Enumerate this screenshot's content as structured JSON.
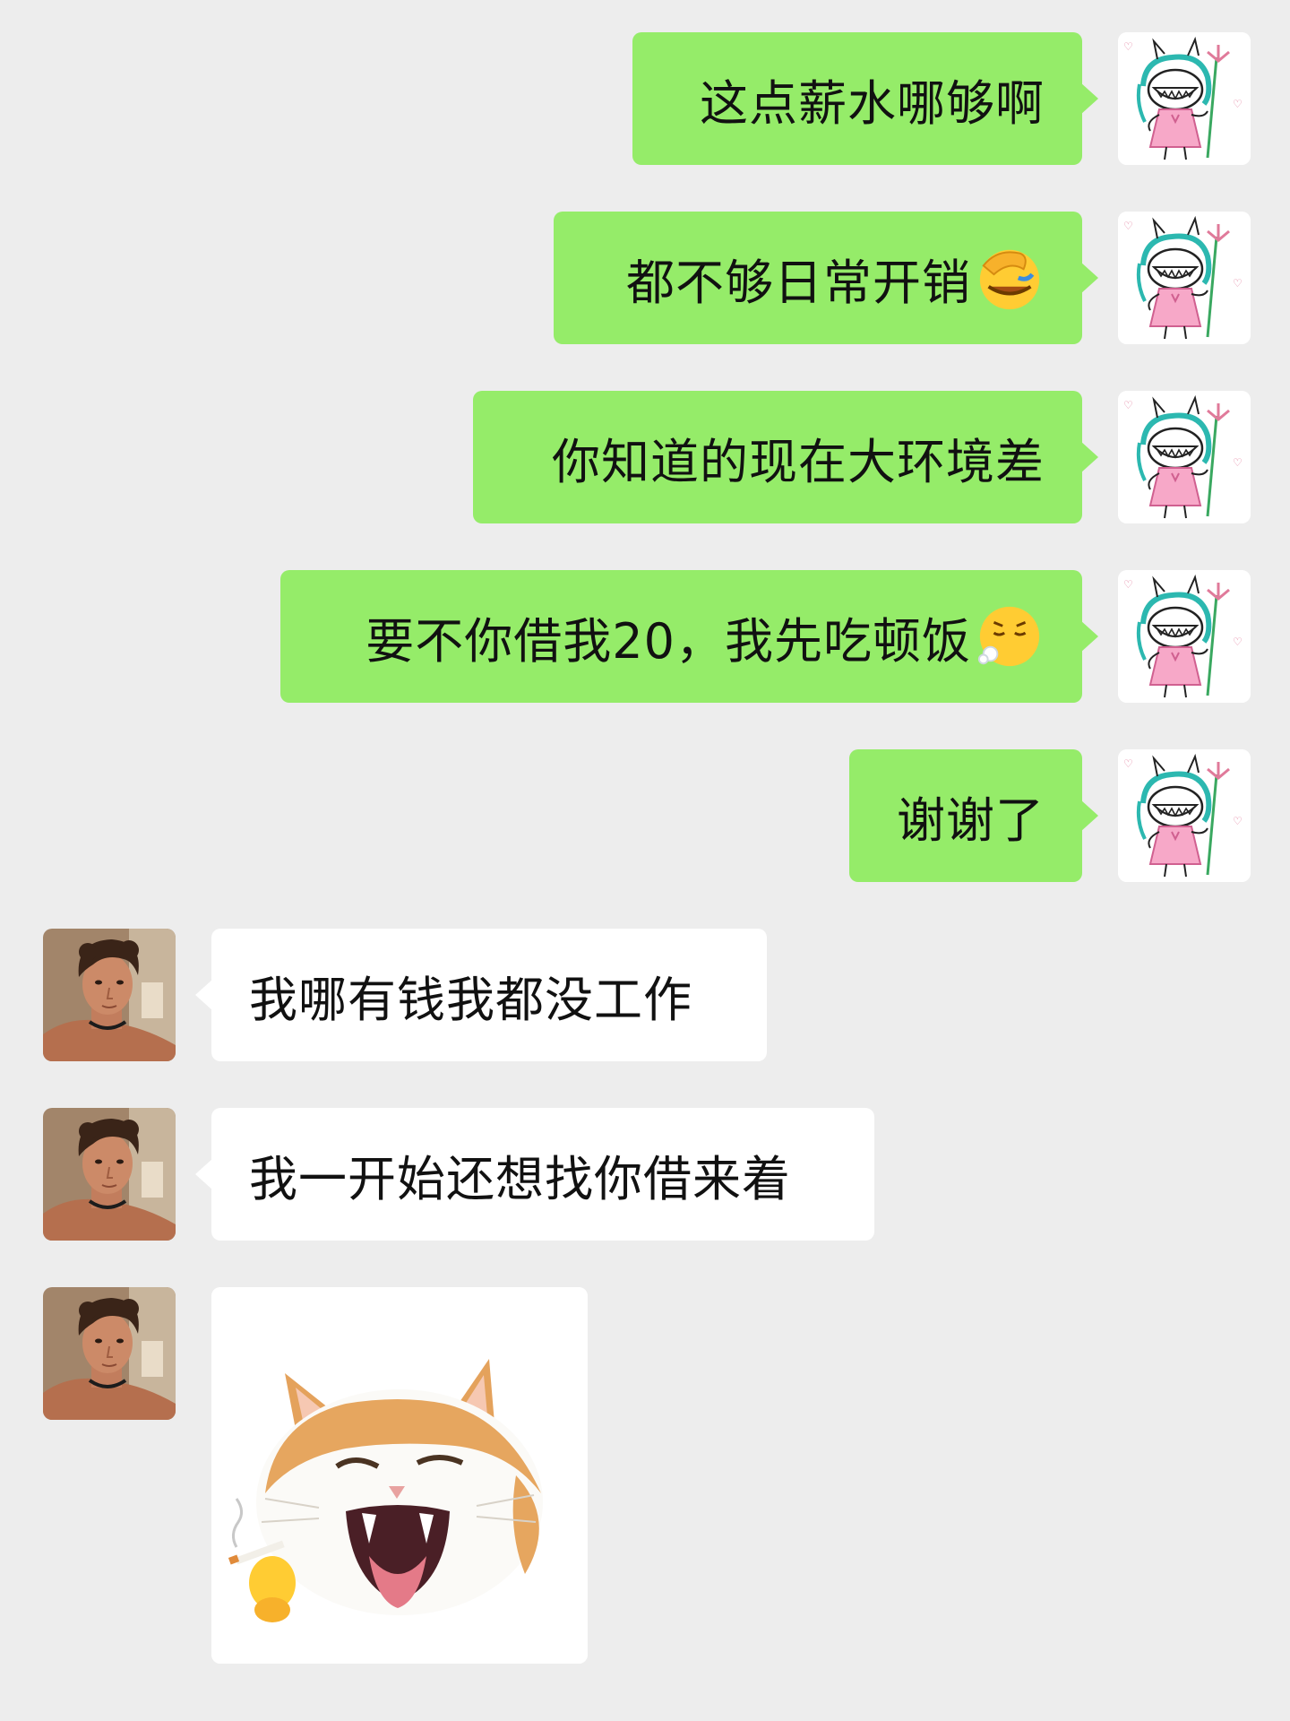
{
  "chat": {
    "messages": [
      {
        "side": "out",
        "text": "这点薪水哪够啊"
      },
      {
        "side": "out",
        "text": "都不够日常开销",
        "emoji": "face-palm-emoji"
      },
      {
        "side": "out",
        "text": "你知道的现在大环境差"
      },
      {
        "side": "out",
        "text": "要不你借我20，我先吃顿饭",
        "emoji": "sighing-face-emoji"
      },
      {
        "side": "out",
        "text": "谢谢了"
      },
      {
        "side": "in",
        "text": "我哪有钱我都没工作"
      },
      {
        "side": "in",
        "text": "我一开始还想找你借来着"
      },
      {
        "side": "in",
        "sticker": "laughing-cat-smoking-sticker"
      }
    ]
  },
  "colors": {
    "background": "#ededed",
    "outgoing_bubble": "#95ec69",
    "incoming_bubble": "#ffffff"
  },
  "icons": {
    "self_avatar": "cartoon-devil-girl-avatar",
    "friend_avatar": "curly-haired-man-photo-avatar"
  }
}
